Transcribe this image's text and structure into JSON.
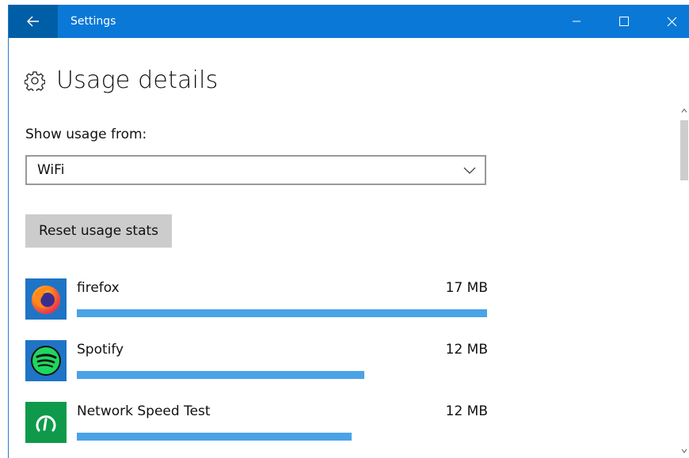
{
  "window": {
    "title": "Settings",
    "controls": [
      "minimize",
      "maximize",
      "close"
    ]
  },
  "page": {
    "title": "Usage details",
    "title_icon": "gear-icon"
  },
  "usage_source": {
    "label": "Show usage from:",
    "selected": "WiFi"
  },
  "actions": {
    "reset_label": "Reset usage stats"
  },
  "apps": [
    {
      "name": "firefox",
      "size": "17 MB",
      "usage_fraction": 1.0,
      "icon": "firefox-icon"
    },
    {
      "name": "Spotify",
      "size": "12 MB",
      "usage_fraction": 0.7,
      "icon": "spotify-icon"
    },
    {
      "name": "Network Speed Test",
      "size": "12 MB",
      "usage_fraction": 0.67,
      "icon": "network-speed-test-icon"
    }
  ],
  "colors": {
    "titlebar": "#0a78d7",
    "back_button": "#005ea6",
    "usage_bar": "#4aa3e6",
    "button_bg": "#cccccc"
  }
}
